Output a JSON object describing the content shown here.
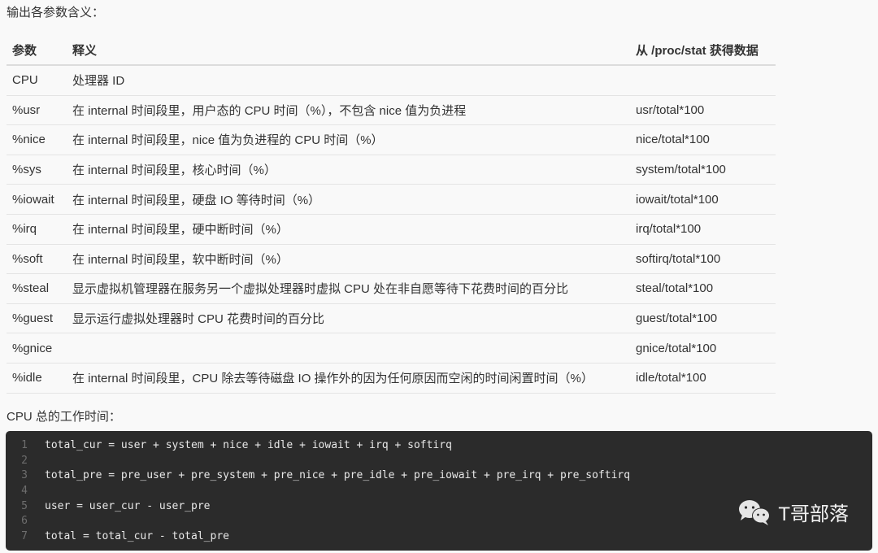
{
  "intro_text": "输出各参数含义：",
  "table": {
    "headers": [
      "参数",
      "释义",
      "从 /proc/stat 获得数据"
    ],
    "rows": [
      {
        "param": "CPU",
        "meaning": "处理器 ID",
        "source": ""
      },
      {
        "param": "%usr",
        "meaning": "在 internal 时间段里，用户态的 CPU 时间（%），不包含 nice 值为负进程",
        "source": "usr/total*100"
      },
      {
        "param": "%nice",
        "meaning": "在 internal 时间段里，nice 值为负进程的 CPU 时间（%）",
        "source": "nice/total*100"
      },
      {
        "param": "%sys",
        "meaning": "在 internal 时间段里，核心时间（%）",
        "source": "system/total*100"
      },
      {
        "param": "%iowait",
        "meaning": "在 internal 时间段里，硬盘 IO 等待时间（%）",
        "source": "iowait/total*100"
      },
      {
        "param": "%irq",
        "meaning": "在 internal 时间段里，硬中断时间（%）",
        "source": "irq/total*100"
      },
      {
        "param": "%soft",
        "meaning": "在 internal 时间段里，软中断时间（%）",
        "source": "softirq/total*100"
      },
      {
        "param": "%steal",
        "meaning": "显示虚拟机管理器在服务另一个虚拟处理器时虚拟 CPU 处在非自愿等待下花费时间的百分比",
        "source": "steal/total*100"
      },
      {
        "param": "%guest",
        "meaning": "显示运行虚拟处理器时 CPU 花费时间的百分比",
        "source": "guest/total*100"
      },
      {
        "param": "%gnice",
        "meaning": "",
        "source": "gnice/total*100"
      },
      {
        "param": "%idle",
        "meaning": "在 internal 时间段里，CPU 除去等待磁盘 IO 操作外的因为任何原因而空闲的时间闲置时间（%）",
        "source": "idle/total*100"
      }
    ]
  },
  "section_label": "CPU 总的工作时间：",
  "code": {
    "lines": [
      {
        "n": "1",
        "text": "total_cur = user + system + nice + idle + iowait + irq + softirq"
      },
      {
        "n": "2",
        "text": ""
      },
      {
        "n": "3",
        "text": "total_pre = pre_user + pre_system + pre_nice + pre_idle + pre_iowait + pre_irq + pre_softirq"
      },
      {
        "n": "4",
        "text": ""
      },
      {
        "n": "5",
        "text": "user = user_cur - user_pre"
      },
      {
        "n": "6",
        "text": ""
      },
      {
        "n": "7",
        "text": "total = total_cur - total_pre"
      }
    ]
  },
  "watermark": {
    "icon": "wechat-icon",
    "text": "T哥部落"
  }
}
